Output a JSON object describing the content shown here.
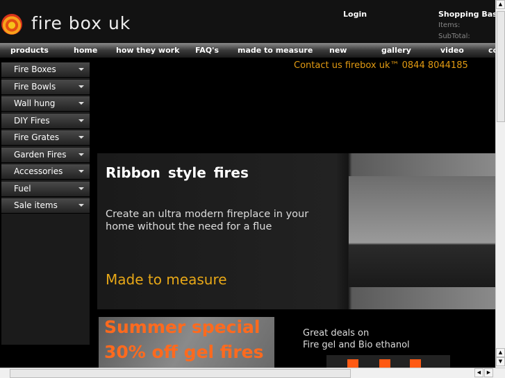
{
  "header": {
    "logo_text": "fire box uk",
    "login": "Login",
    "basket_title": "Shopping Basket",
    "items_label": "Items:",
    "subtotal_label": "SubTotal:"
  },
  "nav": [
    "products",
    "home",
    "how they work",
    "FAQ's",
    "made to measure",
    "new",
    "gallery",
    "video",
    "contact"
  ],
  "contact": "Contact us firebox uk™   0844 8044185",
  "sidebar": [
    "Fire Boxes",
    "Fire Bowls",
    "Wall hung",
    "DIY Fires",
    "Fire Grates",
    "Garden Fires",
    "Accessories",
    "Fuel",
    "Sale items"
  ],
  "banner": {
    "title": "Ribbon  style  fires",
    "desc": "Create an ultra modern fireplace in your home without the need for a flue",
    "made": "Made to measure"
  },
  "promo": {
    "line1": "Summer special",
    "line2": "30% off gel fires"
  },
  "deals": {
    "line1": "Great deals on",
    "line2": "Fire gel and Bio ethanol"
  }
}
